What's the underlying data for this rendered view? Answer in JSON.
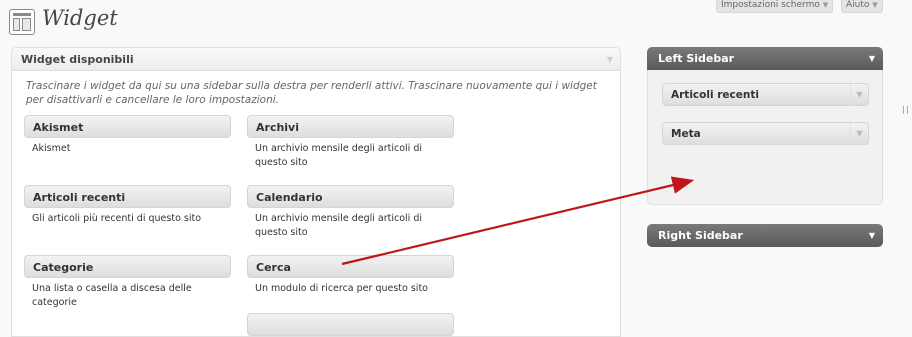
{
  "page": {
    "title": "Widget"
  },
  "top_buttons": {
    "screen_options": "Impostazioni schermo",
    "help": "Aiuto"
  },
  "available": {
    "title": "Widget disponibili",
    "description": "Trascinare i widget da qui su una sidebar sulla destra per renderli attivi. Trascinare nuovamente qui i widget per disattivarli e cancellare le loro impostazioni.",
    "widgets": [
      {
        "name": "Akismet",
        "desc": "Akismet"
      },
      {
        "name": "Archivi",
        "desc": "Un archivio mensile degli articoli di questo sito"
      },
      {
        "name": "Articoli recenti",
        "desc": "Gli articoli più recenti di questo sito"
      },
      {
        "name": "Calendario",
        "desc": "Un archivio mensile degli articoli di questo sito"
      },
      {
        "name": "Categorie",
        "desc": "Una lista o casella a discesa delle categorie"
      },
      {
        "name": "Cerca",
        "desc": "Un modulo di ricerca per questo sito"
      }
    ]
  },
  "sidebars": [
    {
      "title": "Left Sidebar",
      "widgets": [
        "Articoli recenti",
        "Meta"
      ]
    },
    {
      "title": "Right Sidebar",
      "widgets": []
    }
  ],
  "colors": {
    "annotation_arrow": "#c0161b",
    "sidebar_header": "#6d6d6d"
  },
  "icons": {
    "widget_page": "widgets-icon",
    "toggle": "triangle-down-icon"
  }
}
